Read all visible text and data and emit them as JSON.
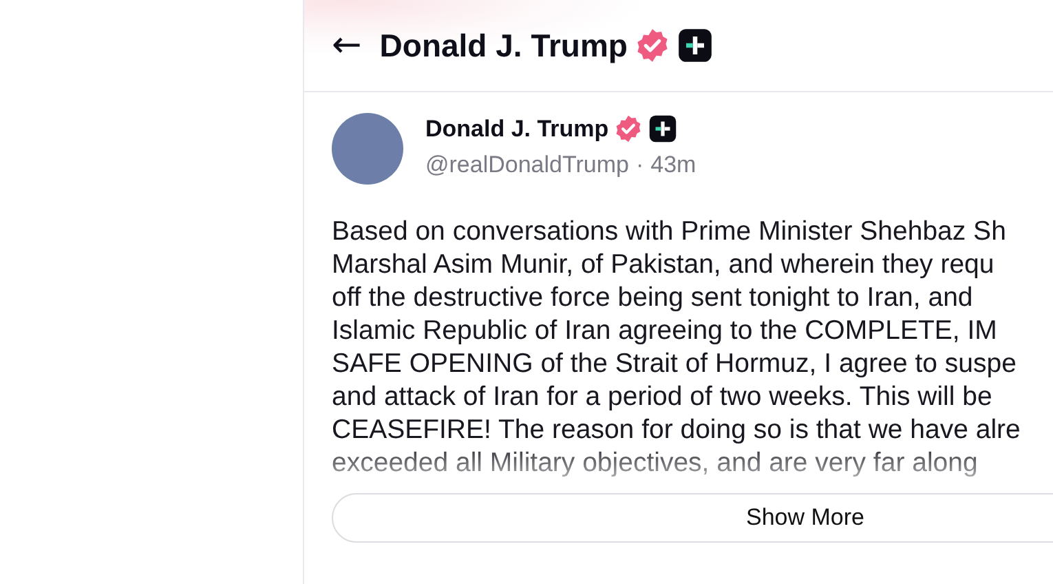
{
  "header": {
    "back": "←",
    "title": "Donald J. Trump"
  },
  "post": {
    "author": "Donald J. Trump",
    "handle": "@realDonaldTrump",
    "separator": "·",
    "time": "43m",
    "lines": [
      "Based on conversations with Prime Minister Shehbaz Sh",
      "Marshal Asim Munir, of Pakistan, and wherein they requ",
      "off the destructive force being sent tonight to Iran, and",
      "Islamic Republic of Iran agreeing to the COMPLETE, IM",
      "SAFE OPENING of the Strait of Hormuz, I agree to suspe",
      "and attack of Iran for a period of two weeks. This will be",
      "CEASEFIRE! The reason for doing so is that we have alre",
      "exceeded all Military objectives, and are very far along"
    ],
    "show_more": "Show More"
  }
}
